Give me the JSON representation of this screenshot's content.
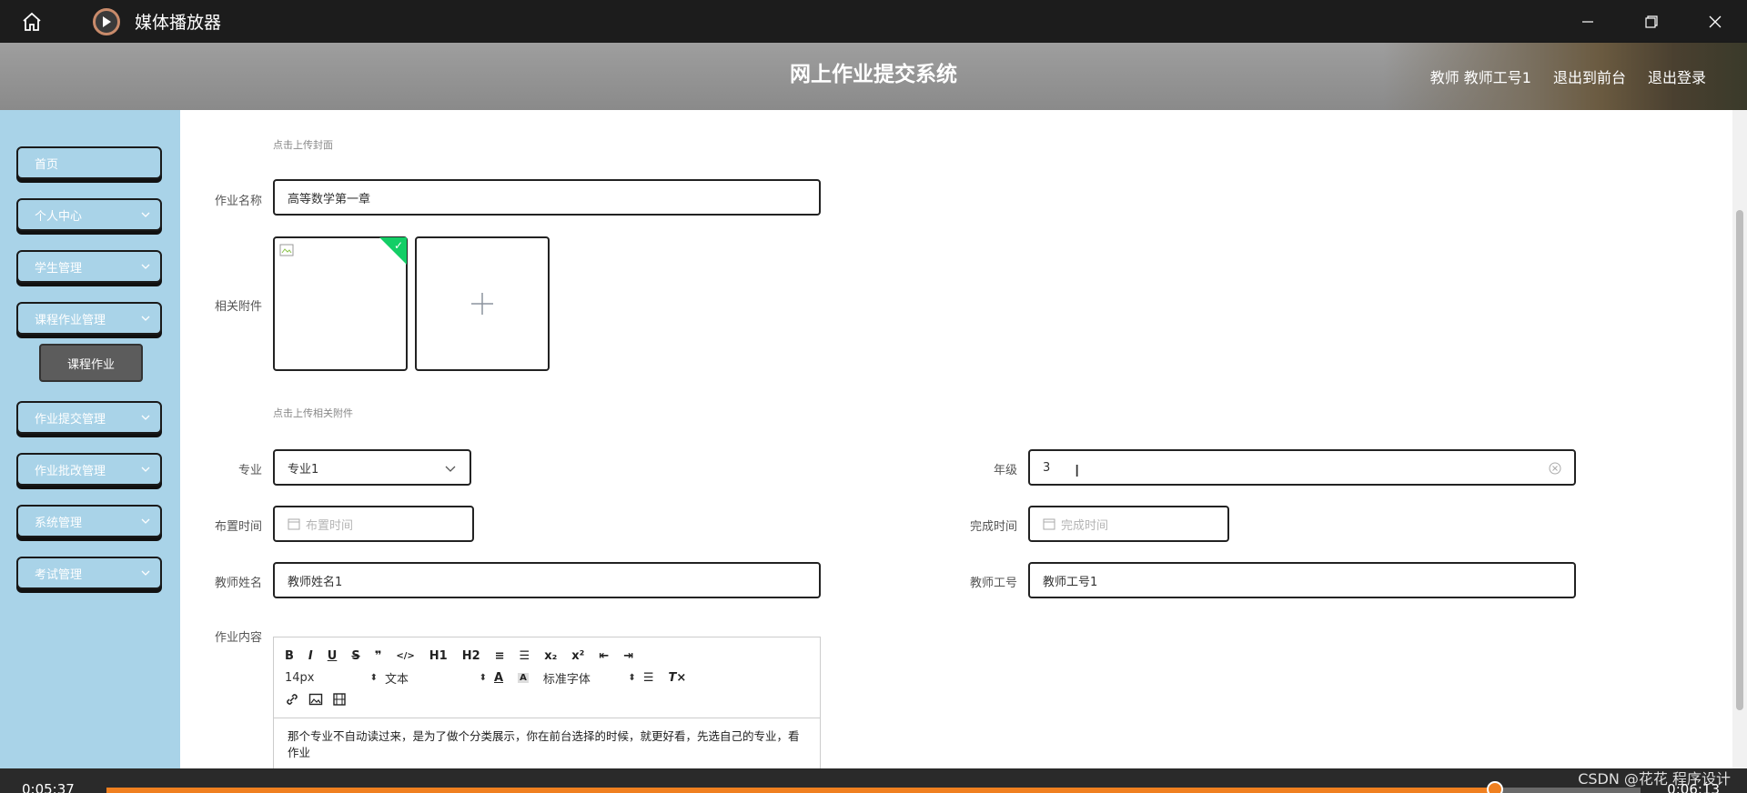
{
  "titlebar": {
    "app_title": "媒体播放器",
    "icons": [
      "home-icon",
      "media-player-logo-icon",
      "minimize-icon",
      "restore-icon",
      "close-icon"
    ]
  },
  "header": {
    "site_title": "网上作业提交系统",
    "user": "教师 教师工号1",
    "back_front": "退出到前台",
    "logout": "退出登录"
  },
  "sidebar": {
    "items": [
      {
        "label": "首页",
        "expandable": false
      },
      {
        "label": "个人中心",
        "expandable": true
      },
      {
        "label": "学生管理",
        "expandable": true
      },
      {
        "label": "课程作业管理",
        "expandable": true
      },
      {
        "label": "作业提交管理",
        "expandable": true
      },
      {
        "label": "作业批改管理",
        "expandable": true
      },
      {
        "label": "系统管理",
        "expandable": true
      },
      {
        "label": "考试管理",
        "expandable": true
      }
    ],
    "sub_item": "课程作业"
  },
  "form": {
    "cover_hint": "点击上传封面",
    "name_label": "作业名称",
    "name_value": "高等数学第一章",
    "attach_label": "相关附件",
    "attach_hint": "点击上传相关附件",
    "major_label": "专业",
    "major_value": "专业1",
    "grade_label": "年级",
    "grade_value": "3",
    "assign_time_label": "布置时间",
    "assign_time_placeholder": "布置时间",
    "finish_time_label": "完成时间",
    "finish_time_placeholder": "完成时间",
    "teacher_name_label": "教师姓名",
    "teacher_name_value": "教师姓名1",
    "teacher_id_label": "教师工号",
    "teacher_id_value": "教师工号1",
    "content_label": "作业内容"
  },
  "editor": {
    "toolbar1": [
      "B",
      "I",
      "U",
      "S",
      "❞",
      "</>",
      "H1",
      "H2",
      "≡",
      "☰",
      "x₂",
      "x²",
      "⇤",
      "⇥"
    ],
    "font_size": "14px",
    "text_style": "文本",
    "font_family": "标准字体",
    "content": "那个专业不自动读过来，是为了做个分类展示，你在前台选择的时候，就更好看，先选自己的专业，看作业"
  },
  "player": {
    "elapsed": "0:05:37",
    "total": "0:06:13",
    "progress": 0.905
  },
  "watermark": "CSDN @花花 程序设计"
}
